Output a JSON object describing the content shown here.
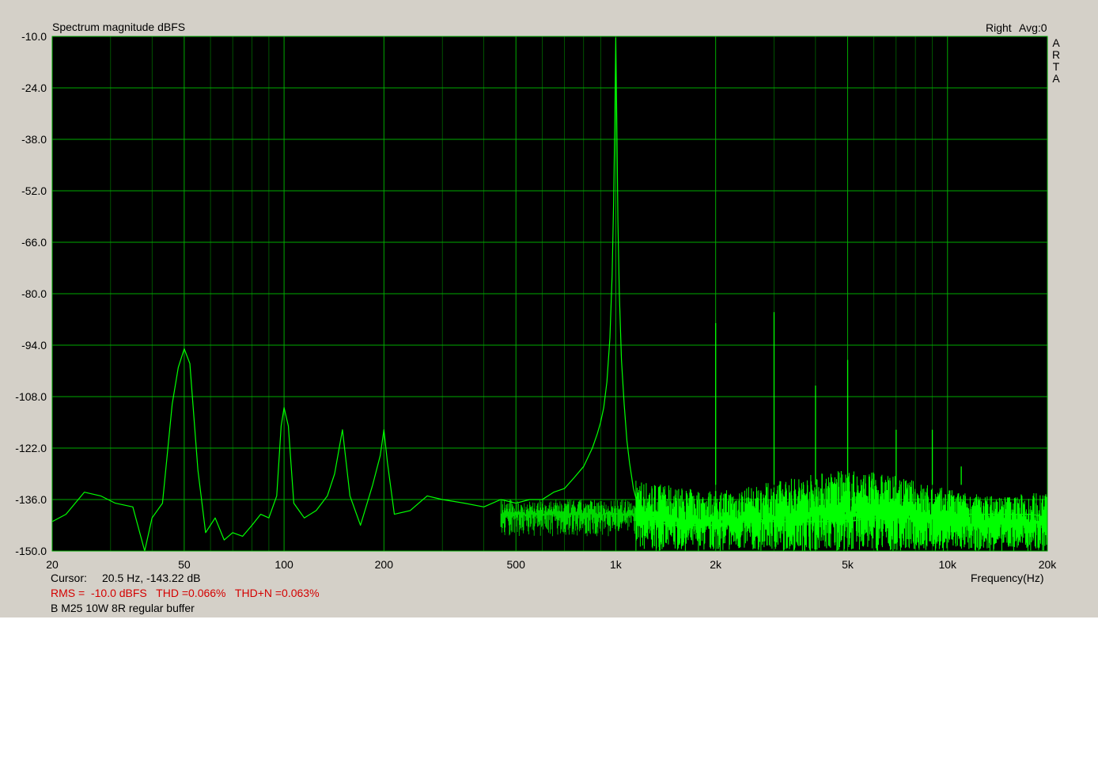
{
  "header": {
    "title": "Spectrum magnitude dBFS",
    "channel": "Right",
    "avg": "Avg:0",
    "brand_letters": [
      "A",
      "R",
      "T",
      "A"
    ]
  },
  "footer": {
    "cursor_label": "Cursor:",
    "cursor_value": "20.5 Hz, -143.22 dB",
    "measurements": "RMS =  -10.0 dBFS   THD =0.066%   THD+N =0.063%",
    "caption": "B M25 10W 8R regular buffer",
    "xlabel": "Frequency(Hz)"
  },
  "colors": {
    "panel": "#d4d0c8",
    "plot_bg": "#000000",
    "grid": "#00aa00",
    "trace": "#00ff00",
    "measurement_text": "#d40000"
  },
  "chart_data": {
    "type": "line",
    "title": "Spectrum magnitude dBFS",
    "xlabel": "Frequency(Hz)",
    "ylabel": "",
    "x_scale": "log",
    "xlim": [
      20,
      20000
    ],
    "ylim": [
      -150,
      -10
    ],
    "grid": true,
    "y_ticks": [
      -10.0,
      -24.0,
      -38.0,
      -52.0,
      -66.0,
      -80.0,
      -94.0,
      -108.0,
      -122.0,
      -136.0,
      -150.0
    ],
    "y_tick_labels": [
      "-10.0",
      "-24.0",
      "-38.0",
      "-52.0",
      "-66.0",
      "-80.0",
      "-94.0",
      "-108.0",
      "-122.0",
      "-136.0",
      "-150.0"
    ],
    "x_ticks": [
      20,
      50,
      100,
      200,
      500,
      1000,
      2000,
      5000,
      10000,
      20000
    ],
    "x_tick_labels": [
      "20",
      "50",
      "100",
      "200",
      "500",
      "1k",
      "2k",
      "5k",
      "10k",
      "20k"
    ],
    "x_minor_grid": [
      30,
      40,
      60,
      70,
      80,
      90,
      300,
      400,
      600,
      700,
      800,
      900,
      3000,
      4000,
      6000,
      7000,
      8000,
      9000
    ],
    "series": [
      {
        "x": [
          20,
          22,
          25,
          28,
          31,
          35,
          38,
          40,
          43,
          46,
          48,
          50,
          52,
          55,
          58,
          62,
          66,
          70,
          75,
          80,
          85,
          90,
          95,
          98,
          100,
          103,
          107,
          115,
          125,
          135,
          142,
          150,
          158,
          170,
          185,
          195,
          200,
          205,
          215,
          240,
          270,
          300,
          350,
          400,
          450,
          500,
          550,
          600,
          650,
          700,
          750,
          800,
          850,
          880,
          900,
          920,
          940,
          960,
          975,
          985,
          993,
          1000,
          1007,
          1015,
          1025,
          1040,
          1060,
          1080,
          1100,
          1130,
          1160,
          1200,
          1300,
          1500,
          1800,
          2000,
          2500,
          3000,
          4000,
          5000,
          6000,
          7000,
          8000,
          10000,
          12000,
          15000,
          18000,
          20000
        ],
        "y": [
          -142,
          -140,
          -134,
          -135,
          -137,
          -138,
          -150,
          -141,
          -137,
          -110,
          -100,
          -95,
          -99,
          -128,
          -145,
          -141,
          -147,
          -145,
          -146,
          -143,
          -140,
          -141,
          -135,
          -116,
          -111,
          -116,
          -137,
          -141,
          -139,
          -135,
          -129,
          -117,
          -135,
          -143,
          -132,
          -124,
          -117,
          -126,
          -140,
          -139,
          -135,
          -136,
          -137,
          -138,
          -136,
          -137,
          -136,
          -136,
          -134,
          -133,
          -130,
          -127,
          -122,
          -118,
          -115,
          -111,
          -104,
          -92,
          -75,
          -55,
          -33,
          -10.5,
          -33,
          -60,
          -80,
          -98,
          -110,
          -120,
          -126,
          -133,
          -137,
          -140,
          -142,
          -143,
          -143,
          -143,
          -142,
          -142,
          -142,
          -142,
          -141,
          -141,
          -141,
          -140,
          -140,
          -140,
          -140,
          -141
        ]
      }
    ],
    "harmonic_spurs": [
      {
        "x": 2000,
        "y": -88
      },
      {
        "x": 3000,
        "y": -85
      },
      {
        "x": 4000,
        "y": -105
      },
      {
        "x": 5000,
        "y": -98
      },
      {
        "x": 6000,
        "y": -129
      },
      {
        "x": 7000,
        "y": -117
      },
      {
        "x": 9000,
        "y": -117
      },
      {
        "x": 11000,
        "y": -127
      }
    ],
    "noise_floor": {
      "x_start": 1150,
      "x_end": 20000,
      "y_min": -150,
      "y_max": -132
    }
  }
}
